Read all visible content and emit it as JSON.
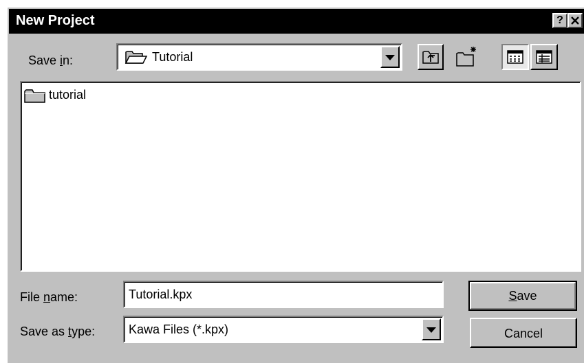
{
  "window": {
    "title": "New Project",
    "help_glyph": "?",
    "close_glyph": "✕"
  },
  "save_in": {
    "label_pre": "Save ",
    "label_key": "i",
    "label_post": "n:",
    "value": "Tutorial",
    "icon": "folder-open-icon"
  },
  "toolbar": {
    "up_folder_icon": "up-one-level-icon",
    "new_folder_icon": "create-new-folder-icon",
    "list_view_icon": "list-view-icon",
    "details_view_icon": "details-view-icon"
  },
  "file_list": {
    "items": [
      {
        "name": "tutorial",
        "icon": "folder-icon"
      }
    ]
  },
  "file_name": {
    "label_pre": "File ",
    "label_key": "n",
    "label_post": "ame:",
    "value": "Tutorial.kpx"
  },
  "save_type": {
    "label_pre": "Save as ",
    "label_key": "t",
    "label_post": "ype:",
    "value": "Kawa Files (*.kpx)"
  },
  "buttons": {
    "save_key": "S",
    "save_rest": "ave",
    "cancel": "Cancel"
  },
  "colors": {
    "face": "#c0c0c0",
    "titlebar": "#000000",
    "window": "#ffffff"
  }
}
